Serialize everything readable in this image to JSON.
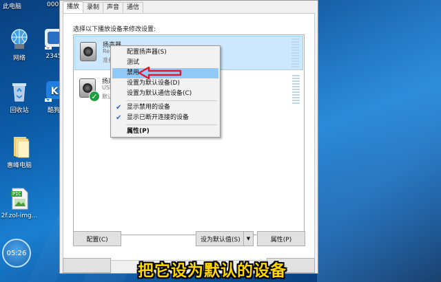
{
  "desktop": {
    "top_labels": [
      "此电脑",
      "000"
    ],
    "icons": [
      {
        "label": "网络"
      },
      {
        "label": "2345"
      },
      {
        "label": "回收站"
      },
      {
        "label": "酷狗"
      },
      {
        "label": "惠峰电脑"
      },
      {
        "label": "2f.zol-img..."
      }
    ],
    "pic_tag": "PIC",
    "clock": "05:26"
  },
  "dialog": {
    "tabs": [
      "播放",
      "录制",
      "声音",
      "通信"
    ],
    "instruction": "选择以下播放设备来修改设置:",
    "devices": [
      {
        "name": "扬声器",
        "line2": "Re",
        "line3": "准备"
      },
      {
        "name": "扬声",
        "line2": "USB",
        "line3": "默认"
      }
    ],
    "buttons": {
      "configure": "配置(C)",
      "set_default": "设为默认值(S)",
      "properties": "属性(P)"
    }
  },
  "context_menu": {
    "items": [
      {
        "label": "配置扬声器(S)"
      },
      {
        "label": "测试"
      },
      {
        "label": "禁用"
      },
      {
        "label": "设置为默认设备(D)"
      },
      {
        "label": "设置为默认通信设备(C)"
      },
      {
        "label": "显示禁用的设备",
        "checked": true
      },
      {
        "label": "显示已断开连接的设备",
        "checked": true
      },
      {
        "label": "属性(P)"
      }
    ]
  },
  "caption": "把它设为默认的设备",
  "colors": {
    "caption": "#ffd600",
    "highlight": "#91c9f7",
    "annotation_arrow": "#e0162b",
    "default_check": "#1e9e3e"
  }
}
